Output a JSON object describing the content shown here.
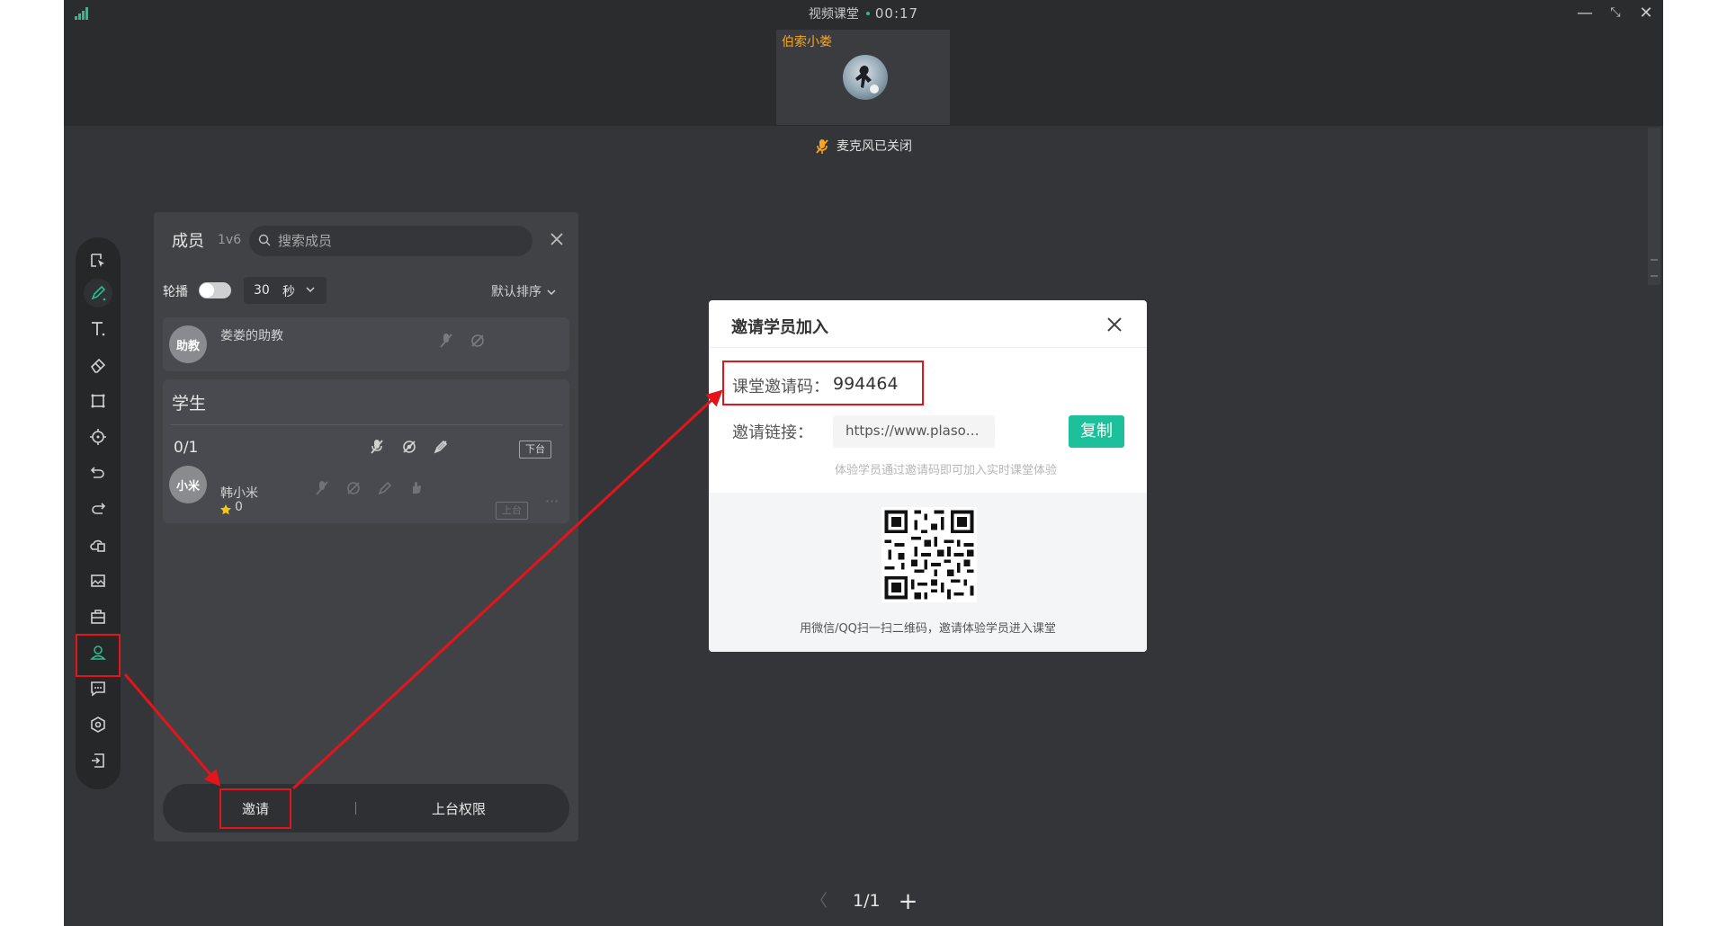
{
  "window": {
    "title": "视频课堂",
    "timer": "00:17",
    "controls": {
      "minimize": "—",
      "restore": "⤡",
      "close": "✕"
    }
  },
  "video_tile": {
    "name": "伯索小娄"
  },
  "mic_notice": "麦克风已关闭",
  "toolbar": {
    "tools": [
      "select",
      "pen",
      "text",
      "eraser",
      "shape",
      "laser",
      "undo",
      "redo",
      "cloud-file",
      "image",
      "toolbox",
      "members",
      "chat",
      "settings",
      "exit"
    ],
    "active": "members"
  },
  "members_panel": {
    "title": "成员",
    "count": "1v6",
    "search_placeholder": "搜索成员",
    "rotate_label": "轮播",
    "interval_value": "30",
    "interval_unit": "秒",
    "sort_label": "默认排序",
    "assistant": {
      "avatar_text": "助教",
      "name": "娄娄的助教"
    },
    "students": {
      "title": "学生",
      "count": "0/1",
      "down_label": "下台",
      "items": [
        {
          "avatar_text": "小米",
          "name": "韩小米",
          "score": "0",
          "up_label": "上台"
        }
      ]
    },
    "bottom": {
      "invite_label": "邀请",
      "permission_label": "上台权限"
    }
  },
  "pager": {
    "prev": "〈",
    "current": "1/1",
    "add": "+"
  },
  "invite_dialog": {
    "title": "邀请学员加入",
    "code_label": "课堂邀请码：",
    "code_value": "994464",
    "link_label": "邀请链接：",
    "link_value": "https://www.plaso.cn/static/y...",
    "copy_label": "复制",
    "hint": "体验学员通过邀请码即可加入实时课堂体验",
    "qr_caption": "用微信/QQ扫一扫二维码，邀请体验学员进入课堂"
  },
  "colors": {
    "accent": "#1cc09a",
    "highlight_box": "#e5141a",
    "presenter_name": "#f5a623",
    "app_bg": "#343538",
    "panel_bg": "#414246"
  }
}
